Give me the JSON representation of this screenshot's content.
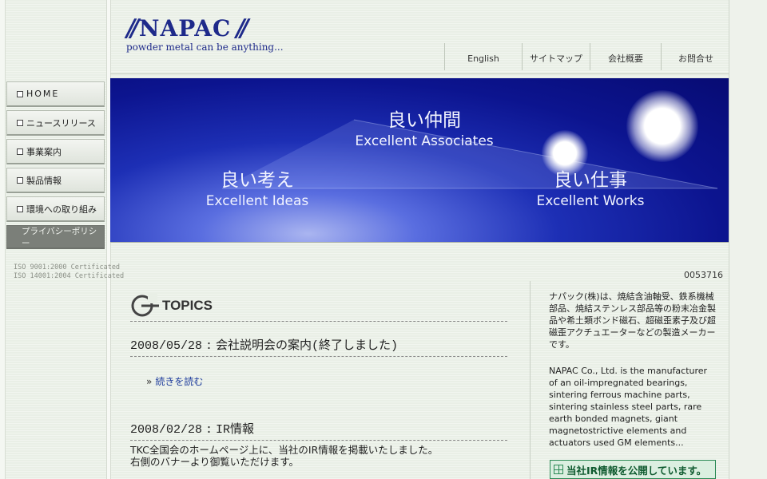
{
  "logo": {
    "name": "NAPAC",
    "slashes": "//",
    "tagline": "powder metal can be anything..."
  },
  "top_nav": [
    {
      "label": "English"
    },
    {
      "label": "サイトマップ"
    },
    {
      "label": "会社概要"
    },
    {
      "label": "お問合せ"
    }
  ],
  "banner": {
    "top": {
      "jp": "良い仲間",
      "en": "Excellent Associates"
    },
    "left": {
      "jp": "良い考え",
      "en": "Excellent Ideas"
    },
    "right": {
      "jp": "良い仕事",
      "en": "Excellent Works"
    }
  },
  "sidebar": {
    "items": [
      {
        "label": "HOME"
      },
      {
        "label": "ニュースリリース"
      },
      {
        "label": "事業案内"
      },
      {
        "label": "製品情報"
      },
      {
        "label": "環境への取り組み"
      },
      {
        "label": "プライバシーポリシー"
      }
    ],
    "iso_lines": [
      "ISO 9001:2000 Certificated",
      "ISO 14001:2004 Certificated"
    ]
  },
  "counter": "0053716",
  "topics": {
    "title": "TOPICS",
    "items": [
      {
        "date": "2008/05/28",
        "sep": ":",
        "title": "会社説明会の案内(終了しました)",
        "more": "続きを読む"
      },
      {
        "date": "2008/02/28",
        "sep": ":",
        "title": "IR情報",
        "body_line1": "TKC全国会のホームページ上に、当社のIR情報を掲載いたしました。",
        "body_line2": "右側のバナーより御覧いただけます。"
      }
    ]
  },
  "info": {
    "jp": "ナパック(株)は、焼結含油軸受、鉄系機械部品、焼結ステンレス部品等の粉末冶金製品や希土類ボンド磁石、超磁歪素子及び超磁歪アクチュエーターなどの製造メーカーです。",
    "en": "NAPAC Co., Ltd. is the manufacturer of an oil-impregnated bearings, sintering ferrous machine parts, sintering stainless steel parts, rare earth bonded magnets, giant magnetostrictive elements and actuators used GM elements..."
  },
  "ir_banner": {
    "label": "当社IR情報を公開しています。"
  },
  "colors": {
    "brand": "#1e2a8a",
    "banner_blue": "#0c148f",
    "ir_green": "#2b8a55"
  }
}
